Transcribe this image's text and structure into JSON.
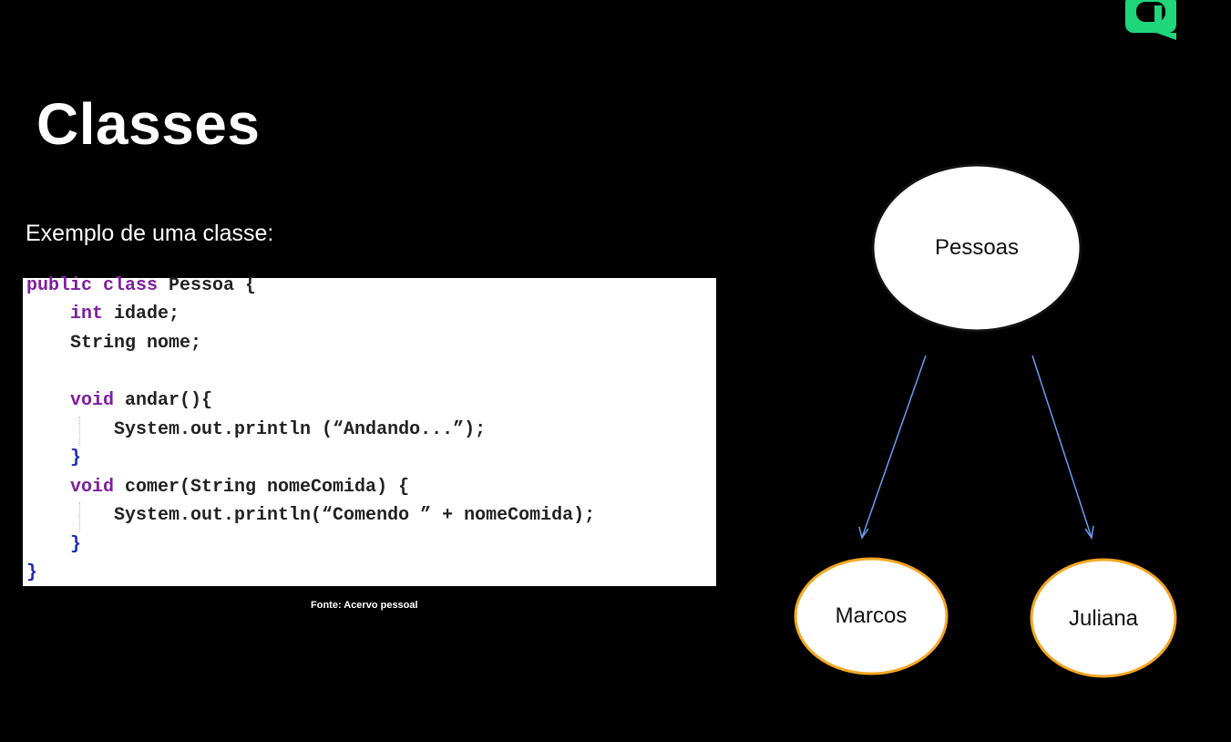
{
  "slide": {
    "title": "Classes",
    "subtitle": "Exemplo de uma classe:",
    "caption": "Fonte: Acervo pessoal"
  },
  "code": {
    "lines": [
      {
        "kw": "public class",
        "rest": " Pessoa {"
      },
      {
        "kw": "    int",
        "rest": " idade;"
      },
      {
        "kw": "",
        "rest": "    String nome;"
      },
      {
        "kw": "",
        "rest": ""
      },
      {
        "kw": "    void",
        "rest": " andar(){"
      },
      {
        "kw": "",
        "rest": "        System.out.println (“Andando...”);"
      },
      {
        "kw": "",
        "rest": "    }"
      },
      {
        "kw": "    void",
        "rest": " comer(String nomeComida) {"
      },
      {
        "kw": "",
        "rest": "        System.out.println(“Comendo ” + nomeComida);"
      },
      {
        "kw": "",
        "rest": "    }"
      },
      {
        "kw": "",
        "rest": "}"
      }
    ]
  },
  "diagram": {
    "parent": {
      "label": "Pessoas",
      "stroke": "#111111",
      "fill": "#ffffff"
    },
    "children": [
      {
        "label": "Marcos",
        "stroke": "#f5a623",
        "fill": "#ffffff"
      },
      {
        "label": "Juliana",
        "stroke": "#f5a623",
        "fill": "#ffffff"
      }
    ],
    "arrow_color": "#6a9cf5"
  },
  "logo": {
    "icon": "brand-logo-icon",
    "color": "#1fd67a"
  }
}
